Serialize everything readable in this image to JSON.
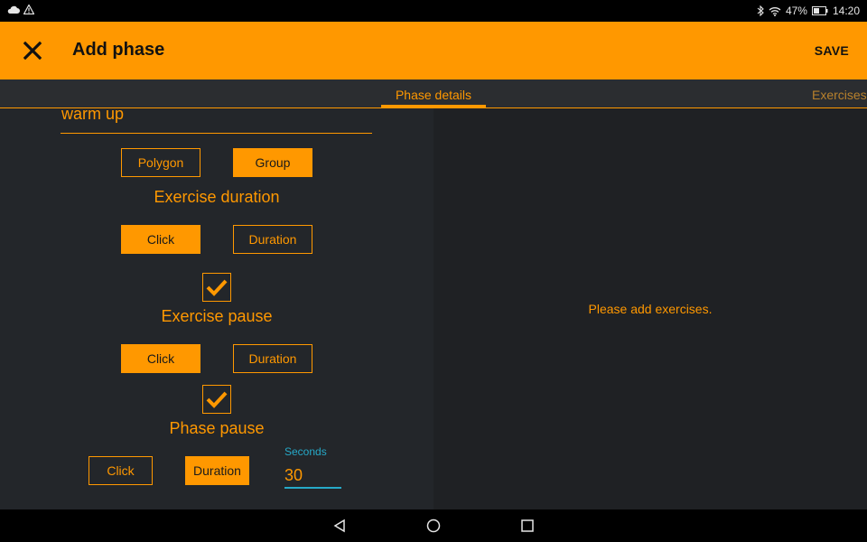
{
  "status_bar": {
    "icons": [
      "cloud-icon",
      "warning-icon"
    ],
    "battery": "47%",
    "time": "14:20"
  },
  "app_bar": {
    "title": "Add phase",
    "save_label": "SAVE"
  },
  "tabs": [
    {
      "label": "Phase details"
    },
    {
      "label": "Exercises"
    }
  ],
  "form": {
    "name_value": "warm up",
    "type_options": [
      "Polygon",
      "Group"
    ],
    "type_selected": "Group",
    "exercise_duration": {
      "label": "Exercise duration",
      "options": [
        "Click",
        "Duration"
      ],
      "selected": "Click"
    },
    "exercise_pause": {
      "label": "Exercise pause",
      "enabled": true,
      "options": [
        "Click",
        "Duration"
      ],
      "selected": "Click"
    },
    "phase_pause": {
      "label": "Phase pause",
      "enabled": true,
      "options": [
        "Click",
        "Duration"
      ],
      "selected": "Duration",
      "seconds_label": "Seconds",
      "seconds_value": "30"
    }
  },
  "exercises_panel": {
    "empty_message": "Please add exercises."
  },
  "colors": {
    "accent": "#ff9800",
    "input_focus": "#26a9c8",
    "panel_left": "#23262a",
    "panel_right": "#1f2124"
  }
}
